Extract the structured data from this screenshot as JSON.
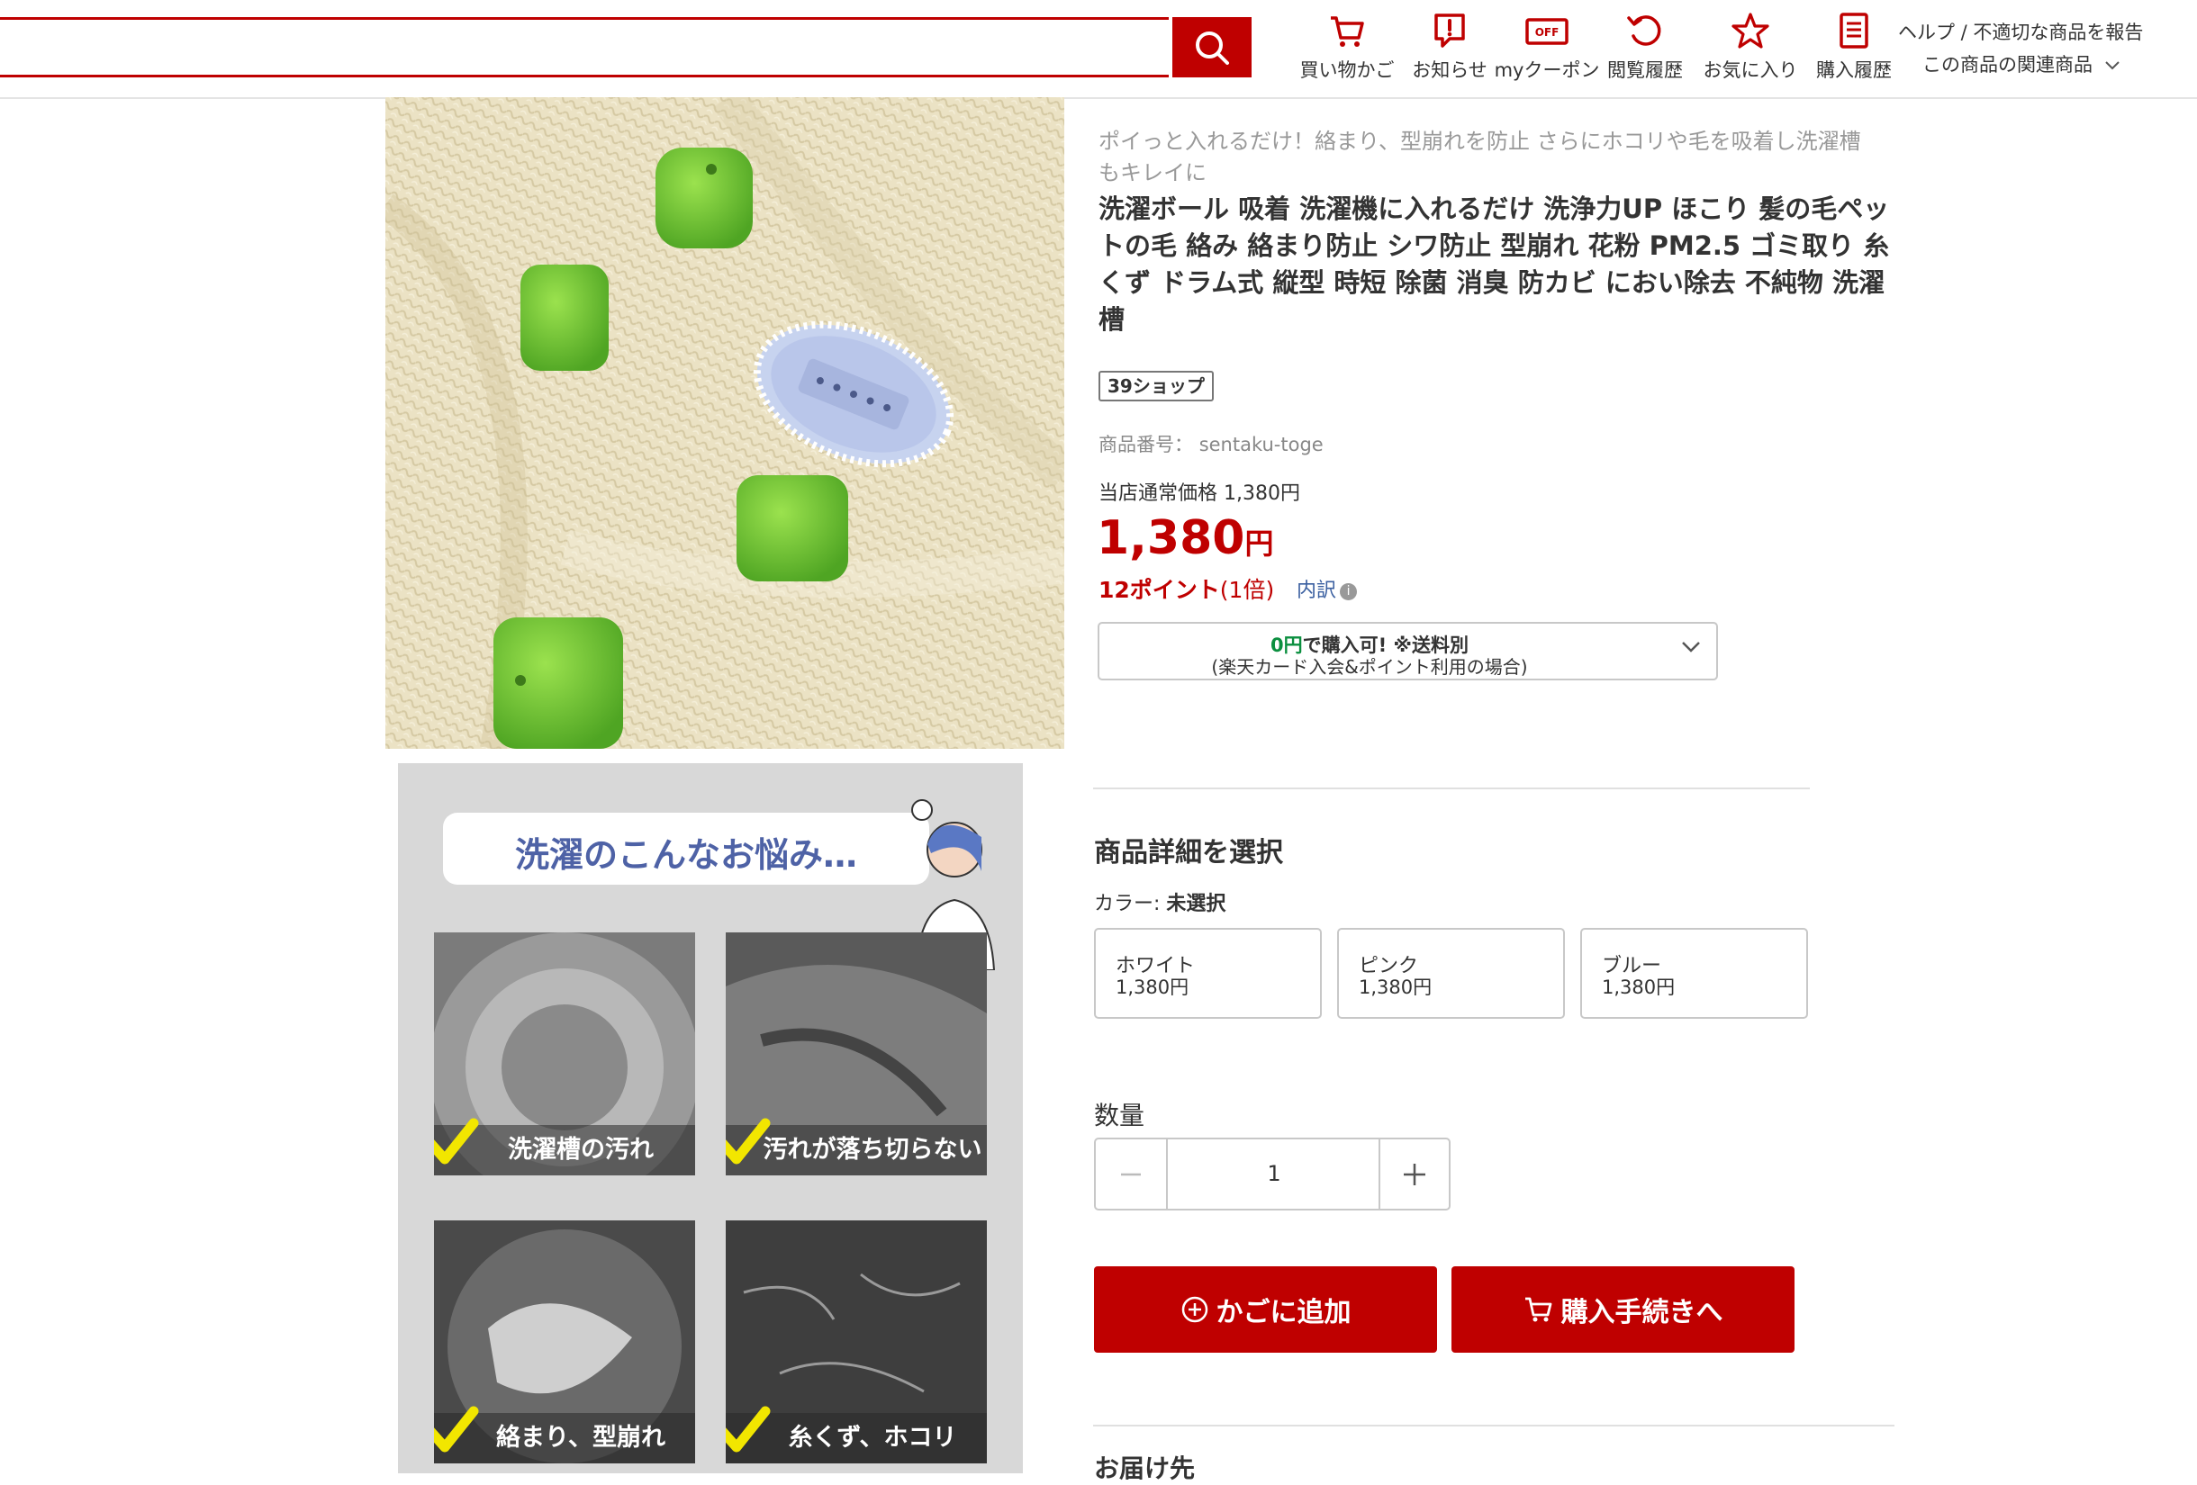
{
  "header": {
    "search_placeholder": "",
    "nav": [
      {
        "label": "買い物かご",
        "icon": "cart-icon"
      },
      {
        "label": "お知らせ",
        "icon": "notice-icon"
      },
      {
        "label": "myクーポン",
        "icon": "coupon-icon"
      },
      {
        "label": "閲覧履歴",
        "icon": "history-icon"
      },
      {
        "label": "お気に入り",
        "icon": "star-icon"
      },
      {
        "label": "購入履歴",
        "icon": "receipt-icon"
      }
    ],
    "help_link": "ヘルプ / 不適切な商品を報告",
    "related_link": "この商品の関連商品",
    "coupon_icon_text": "OFF"
  },
  "product": {
    "catch_copy": "ポイっと入れるだけ！絡まり、型崩れを防止 さらにホコリや毛を吸着し洗濯槽もキレイに",
    "title": "洗濯ボール 吸着 洗濯機に入れるだけ 洗浄力UP ほこり 髪の毛ペットの毛 絡み 絡まり防止 シワ防止 型崩れ 花粉 PM2.5 ゴミ取り 糸くず ドラム式 縦型 時短 除菌 消臭 防カビ におい除去 不純物 洗濯槽",
    "shop_badge": "39ショップ",
    "item_number_label": "商品番号：",
    "item_number": "sentaku-toge",
    "regular_price": "当店通常価格 1,380円",
    "price": "1,380",
    "price_unit": "円",
    "points": "12ポイント",
    "points_multiplier": "(1倍)",
    "breakdown_link": "内訳",
    "card_offer": {
      "zero": "0円",
      "line1_rest": "で購入可! ※送料別",
      "line2": "(楽天カード入会&ポイント利用の場合)"
    }
  },
  "selection": {
    "heading": "商品詳細を選択",
    "color_label": "カラー:",
    "color_selected": "未選択",
    "options": [
      {
        "name": "ホワイト",
        "price": "1,380円"
      },
      {
        "name": "ピンク",
        "price": "1,380円"
      },
      {
        "name": "ブルー",
        "price": "1,380円"
      }
    ]
  },
  "quantity": {
    "label": "数量",
    "value": "1"
  },
  "actions": {
    "add_to_cart": "かごに追加",
    "checkout": "購入手続きへ"
  },
  "delivery": {
    "heading": "お届け先"
  },
  "detail_image": {
    "title": "洗濯のこんなお悩み…",
    "captions": [
      "洗濯槽の汚れ",
      "汚れが落ち切らない",
      "絡まり、型崩れ",
      "糸くず、ホコリ"
    ]
  },
  "colors": {
    "accent": "#bf0000",
    "green": "#0b8f3f",
    "link": "#3a5fa0"
  }
}
